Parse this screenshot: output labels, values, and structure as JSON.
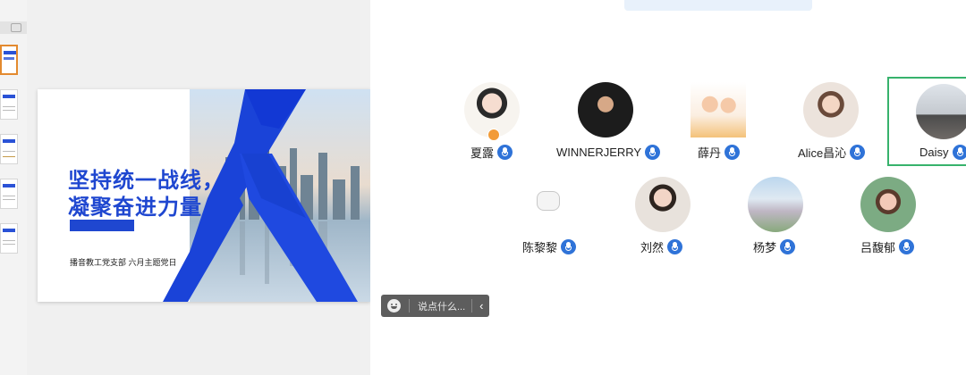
{
  "slide": {
    "title_line1": "坚持统一战线，",
    "title_line2": "凝聚奋进力量",
    "subtitle": "播音教工党支部 六月主题党日"
  },
  "participants": [
    {
      "name": "夏露",
      "host": true
    },
    {
      "name": "WINNERJERRY",
      "host": false
    },
    {
      "name": "薛丹",
      "host": false
    },
    {
      "name": "Alice昌沁",
      "host": false
    },
    {
      "name": "Daisy",
      "host": false,
      "selected": true
    },
    {
      "name": "陈黎黎",
      "host": false
    },
    {
      "name": "刘然",
      "host": false
    },
    {
      "name": "杨梦",
      "host": false
    },
    {
      "name": "吕馥郁",
      "host": false
    }
  ],
  "chat": {
    "placeholder": "说点什么..."
  },
  "icons": {
    "mic": "microphone-icon",
    "emoji": "emoji-icon",
    "collapse": "chevron-left-icon",
    "host": "host-badge-icon"
  },
  "colors": {
    "accent": "#1f47d0",
    "mic": "#2f73d8",
    "selected_border": "#37b26c",
    "chat_bg": "#5d5d5d"
  }
}
